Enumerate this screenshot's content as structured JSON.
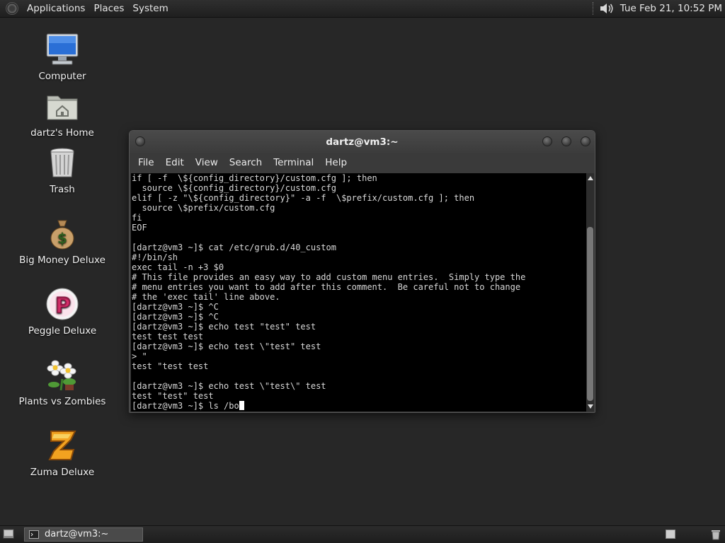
{
  "top_panel": {
    "menus": [
      "Applications",
      "Places",
      "System"
    ],
    "clock": "Tue Feb 21, 10:52 PM"
  },
  "desktop_icons": [
    {
      "label": "Computer",
      "icon": "computer-icon"
    },
    {
      "label": "dartz's Home",
      "icon": "home-folder-icon"
    },
    {
      "label": "Trash",
      "icon": "trash-icon"
    },
    {
      "label": "Big Money Deluxe",
      "icon": "money-bag-icon"
    },
    {
      "label": "Peggle Deluxe",
      "icon": "peggle-icon"
    },
    {
      "label": "Plants vs Zombies",
      "icon": "plants-vs-zombies-icon"
    },
    {
      "label": "Zuma Deluxe",
      "icon": "zuma-icon"
    }
  ],
  "terminal": {
    "title": "dartz@vm3:~",
    "menus": [
      "File",
      "Edit",
      "View",
      "Search",
      "Terminal",
      "Help"
    ],
    "lines": [
      "if [ -f  \\${config_directory}/custom.cfg ]; then",
      "  source \\${config_directory}/custom.cfg",
      "elif [ -z \"\\${config_directory}\" -a -f  \\$prefix/custom.cfg ]; then",
      "  source \\$prefix/custom.cfg",
      "fi",
      "EOF",
      "",
      "[dartz@vm3 ~]$ cat /etc/grub.d/40_custom",
      "#!/bin/sh",
      "exec tail -n +3 $0",
      "# This file provides an easy way to add custom menu entries.  Simply type the",
      "# menu entries you want to add after this comment.  Be careful not to change",
      "# the 'exec tail' line above.",
      "[dartz@vm3 ~]$ ^C",
      "[dartz@vm3 ~]$ ^C",
      "[dartz@vm3 ~]$ echo test \"test\" test",
      "test test test",
      "[dartz@vm3 ~]$ echo test \\\"test\" test",
      "> \"",
      "test \"test test",
      "",
      "[dartz@vm3 ~]$ echo test \\\"test\\\" test",
      "test \"test\" test"
    ],
    "current_input": "[dartz@vm3 ~]$ ls /bo"
  },
  "taskbar": {
    "task_label": "dartz@vm3:~"
  }
}
